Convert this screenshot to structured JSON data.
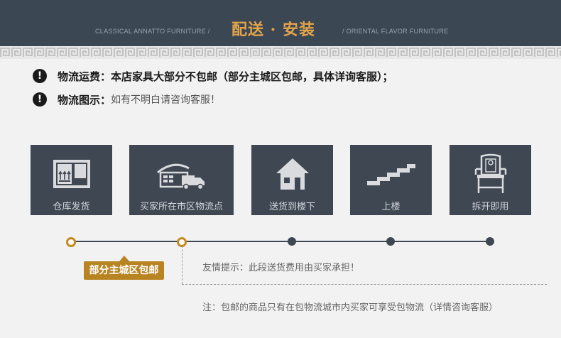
{
  "header": {
    "title": "配送 · 安装",
    "left_subtitle": "CLASSICAL ANNATTO FURNITURE /",
    "right_subtitle": "/ ORIENTAL FLAVOR FURNITURE"
  },
  "notices": [
    {
      "label": "物流运费：",
      "text": "本店家具大部分不包邮（部分主城区包邮，具体详询客服）；"
    },
    {
      "label": "物流图示：",
      "text": "如有不明白请咨询客服！"
    }
  ],
  "steps": [
    {
      "label": "仓库发货",
      "icon": "warehouse-box-icon"
    },
    {
      "label": "买家所在市区物流点",
      "icon": "logistics-truck-icon"
    },
    {
      "label": "送货到楼下",
      "icon": "house-icon"
    },
    {
      "label": "上楼",
      "icon": "stairs-icon"
    },
    {
      "label": "拆开即用",
      "icon": "chair-icon"
    }
  ],
  "badge": {
    "label": "部分主城区包邮"
  },
  "tip": "友情提示：此段送货费用由买家承担！",
  "note": "注：包邮的商品只有在包物流城市内买家可享受包物流（详情咨询客服）",
  "colors": {
    "header_bg": "#3c4754",
    "accent": "#b88422",
    "title_gold": "#e2a44a",
    "step_bg": "#3f4753"
  }
}
